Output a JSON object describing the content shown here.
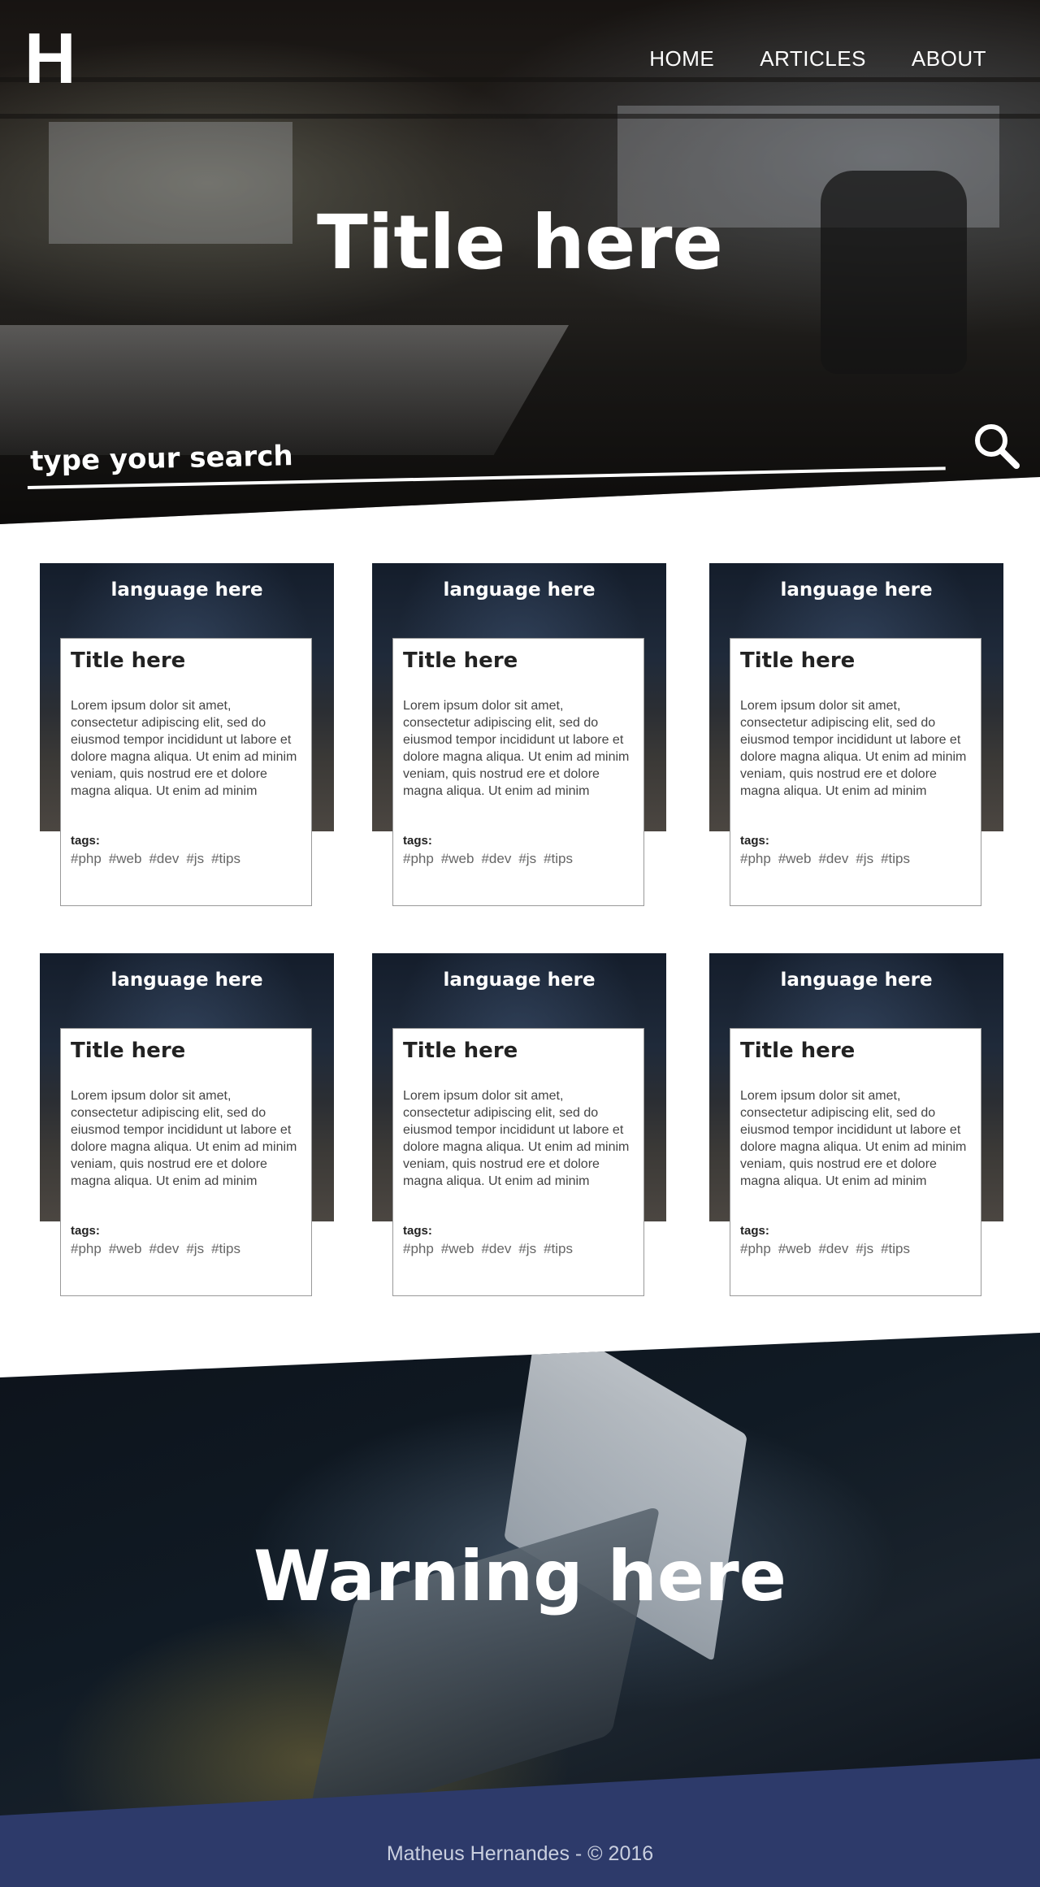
{
  "header": {
    "logo": "H",
    "nav": [
      {
        "label": "HOME"
      },
      {
        "label": "ARTICLES"
      },
      {
        "label": "ABOUT"
      }
    ]
  },
  "hero": {
    "title": "Title here",
    "search_placeholder": "type your search",
    "search_icon": "search-icon"
  },
  "cards": [
    {
      "language": "language here",
      "title": "Title here",
      "text": "Lorem ipsum dolor sit amet, consectetur adipiscing elit, sed do eiusmod tempor incididunt ut labore et dolore magna aliqua. Ut enim ad minim veniam, quis nostrud ere et dolore magna aliqua. Ut enim ad minim veniam, quis nostrud e",
      "tags_label": "tags:",
      "tags": [
        "#php",
        "#web",
        "#dev",
        "#js",
        "#tips"
      ]
    },
    {
      "language": "language here",
      "title": "Title here",
      "text": "Lorem ipsum dolor sit amet, consectetur adipiscing elit, sed do eiusmod tempor incididunt ut labore et dolore magna aliqua. Ut enim ad minim veniam, quis nostrud ere et dolore magna aliqua. Ut enim ad minim veniam, quis nostrud e",
      "tags_label": "tags:",
      "tags": [
        "#php",
        "#web",
        "#dev",
        "#js",
        "#tips"
      ]
    },
    {
      "language": "language here",
      "title": "Title here",
      "text": "Lorem ipsum dolor sit amet, consectetur adipiscing elit, sed do eiusmod tempor incididunt ut labore et dolore magna aliqua. Ut enim ad minim veniam, quis nostrud ere et dolore magna aliqua. Ut enim ad minim veniam, quis nostrud e",
      "tags_label": "tags:",
      "tags": [
        "#php",
        "#web",
        "#dev",
        "#js",
        "#tips"
      ]
    },
    {
      "language": "language here",
      "title": "Title here",
      "text": "Lorem ipsum dolor sit amet, consectetur adipiscing elit, sed do eiusmod tempor incididunt ut labore et dolore magna aliqua. Ut enim ad minim veniam, quis nostrud ere et dolore magna aliqua. Ut enim ad minim veniam, quis nostrud e",
      "tags_label": "tags:",
      "tags": [
        "#php",
        "#web",
        "#dev",
        "#js",
        "#tips"
      ]
    },
    {
      "language": "language here",
      "title": "Title here",
      "text": "Lorem ipsum dolor sit amet, consectetur adipiscing elit, sed do eiusmod tempor incididunt ut labore et dolore magna aliqua. Ut enim ad minim veniam, quis nostrud ere et dolore magna aliqua. Ut enim ad minim veniam, quis nostrud e",
      "tags_label": "tags:",
      "tags": [
        "#php",
        "#web",
        "#dev",
        "#js",
        "#tips"
      ]
    },
    {
      "language": "language here",
      "title": "Title here",
      "text": "Lorem ipsum dolor sit amet, consectetur adipiscing elit, sed do eiusmod tempor incididunt ut labore et dolore magna aliqua. Ut enim ad minim veniam, quis nostrud ere et dolore magna aliqua. Ut enim ad minim veniam, quis nostrud e",
      "tags_label": "tags:",
      "tags": [
        "#php",
        "#web",
        "#dev",
        "#js",
        "#tips"
      ]
    }
  ],
  "warning": {
    "title": "Warning here"
  },
  "footer": {
    "text": "Matheus Hernandes - © 2016"
  },
  "colors": {
    "footer_bg": "#2d3a6a",
    "text_light": "#ffffff"
  }
}
